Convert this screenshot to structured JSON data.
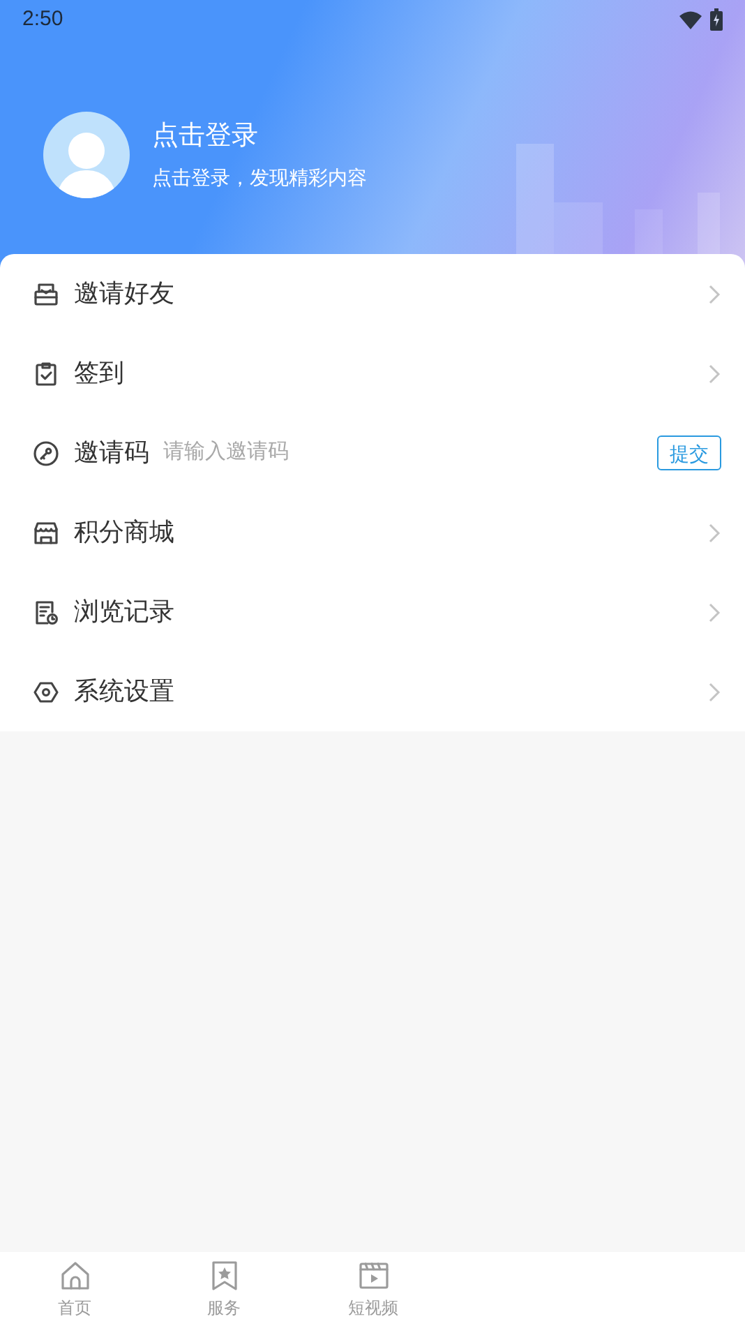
{
  "status_bar": {
    "time": "2:50"
  },
  "profile": {
    "title": "点击登录",
    "subtitle": "点击登录，发现精彩内容"
  },
  "menu": [
    {
      "kind": "link",
      "label": "邀请好友"
    },
    {
      "kind": "link",
      "label": "签到"
    },
    {
      "kind": "code_input",
      "label": "邀请码",
      "placeholder": "请输入邀请码",
      "button": "提交"
    },
    {
      "kind": "link",
      "label": "积分商城"
    },
    {
      "kind": "link",
      "label": "浏览记录"
    },
    {
      "kind": "link",
      "label": "系统设置"
    }
  ],
  "bottom_nav": [
    {
      "label": "首页",
      "selected": false
    },
    {
      "label": "服务",
      "selected": false
    },
    {
      "label": "短视频",
      "selected": false
    }
  ]
}
